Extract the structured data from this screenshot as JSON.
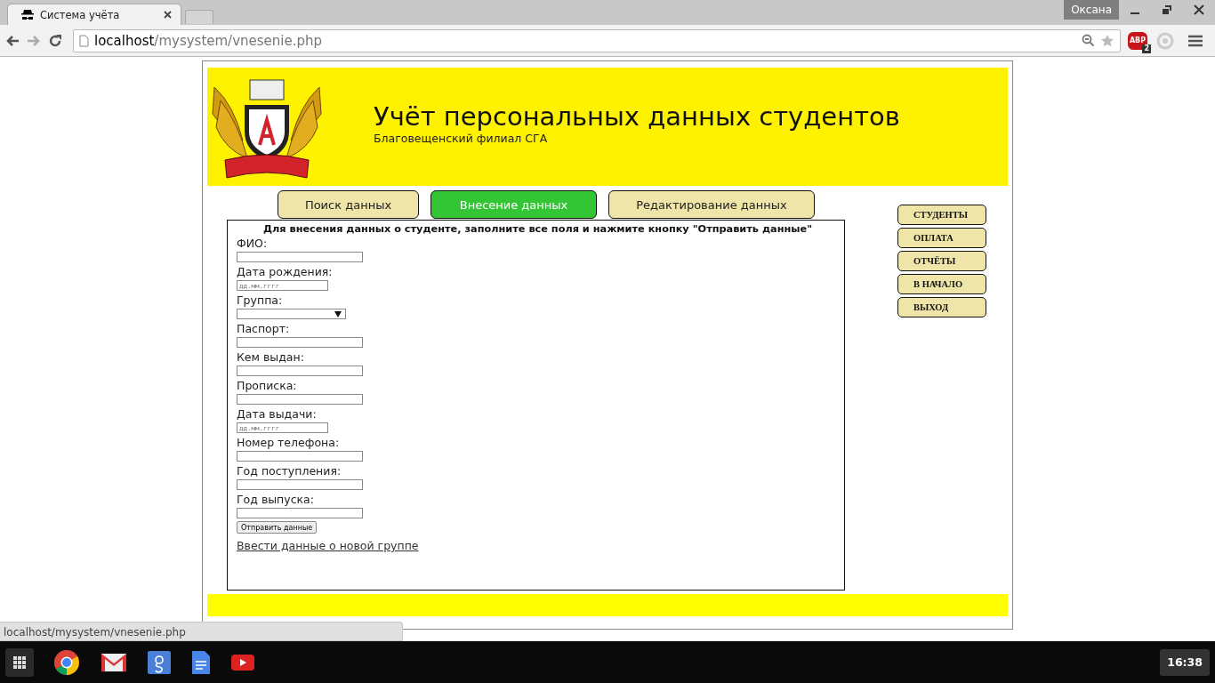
{
  "browser": {
    "tab": {
      "title": "Система учёта"
    },
    "profile": "Оксана",
    "address": {
      "host": "localhost",
      "path": "/mysystem/vnesenie.php"
    },
    "extension": {
      "label": "ABP",
      "count": "2"
    }
  },
  "header": {
    "title": "Учёт персональных данных студентов",
    "subtitle": "Благовещенский филиал СГА"
  },
  "nav": [
    {
      "label": "Поиск данных",
      "selected": false
    },
    {
      "label": "Внесение данных",
      "selected": true
    },
    {
      "label": "Редактирование данных",
      "selected": false
    }
  ],
  "form": {
    "heading": "Для внесения данных о студенте, заполните все поля и нажмите кнопку \"Отправить данные\"",
    "fields": [
      {
        "label": "ФИО:",
        "kind": "text"
      },
      {
        "label": "Дата рождения:",
        "kind": "date",
        "placeholder": "дд.мм.гггг"
      },
      {
        "label": "Группа:",
        "kind": "select"
      },
      {
        "label": "Паспорт:",
        "kind": "text"
      },
      {
        "label": "Кем выдан:",
        "kind": "text"
      },
      {
        "label": "Прописка:",
        "kind": "text"
      },
      {
        "label": "Дата выдачи:",
        "kind": "date",
        "placeholder": "дд.мм.гггг"
      },
      {
        "label": "Номер телефона:",
        "kind": "text"
      },
      {
        "label": "Год поступления:",
        "kind": "text"
      },
      {
        "label": "Год выпуска:",
        "kind": "text"
      }
    ],
    "submit": "Отправить данные",
    "link": "Ввести данные о новой группе"
  },
  "side_menu": [
    "СТУДЕНТЫ",
    "ОПЛАТА",
    "ОТЧЁТЫ",
    "В НАЧАЛО",
    "ВЫХОД"
  ],
  "status_bar": "localhost/mysystem/vnesenie.php",
  "taskbar": {
    "clock": "16:38"
  }
}
